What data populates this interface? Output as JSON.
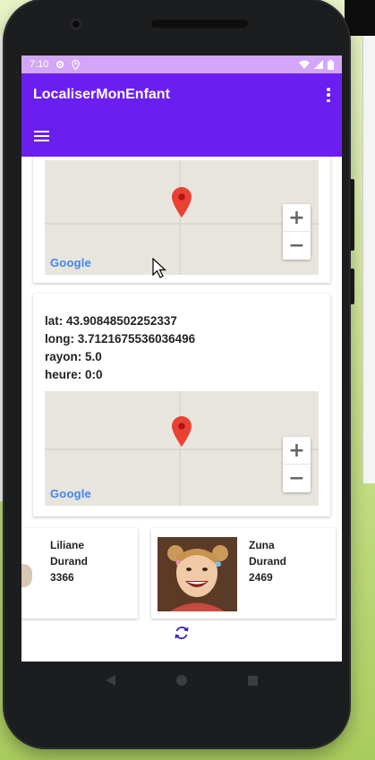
{
  "status_bar": {
    "time": "7:10"
  },
  "app_bar": {
    "title": "LocaliserMonEnfant"
  },
  "map_cards": [
    {
      "google_label": "Google",
      "zoom_in": "+",
      "zoom_out": "−"
    },
    {
      "lat": "lat: 43.90848502252337",
      "long": "long: 3.7121675536036496",
      "rayon": "rayon: 5.0",
      "heure": "heure: 0:0",
      "google_label": "Google",
      "zoom_in": "+",
      "zoom_out": "−"
    }
  ],
  "children": [
    {
      "first_name": "Liliane",
      "last_name": "Durand",
      "code": "3366"
    },
    {
      "first_name": "Zuna",
      "last_name": "Durand",
      "code": "2469"
    }
  ],
  "colors": {
    "app_bar": "#6a1ef0",
    "status_bar": "#d3a6f7",
    "accent": "#3f1fb8",
    "map_pin": "#e94235"
  },
  "icons": {
    "settings": "gear-icon",
    "location": "location-icon",
    "wifi": "wifi-icon",
    "signal": "signal-icon",
    "battery": "battery-icon",
    "menu": "hamburger-icon",
    "overflow": "overflow-menu-icon",
    "refresh": "refresh-icon"
  }
}
